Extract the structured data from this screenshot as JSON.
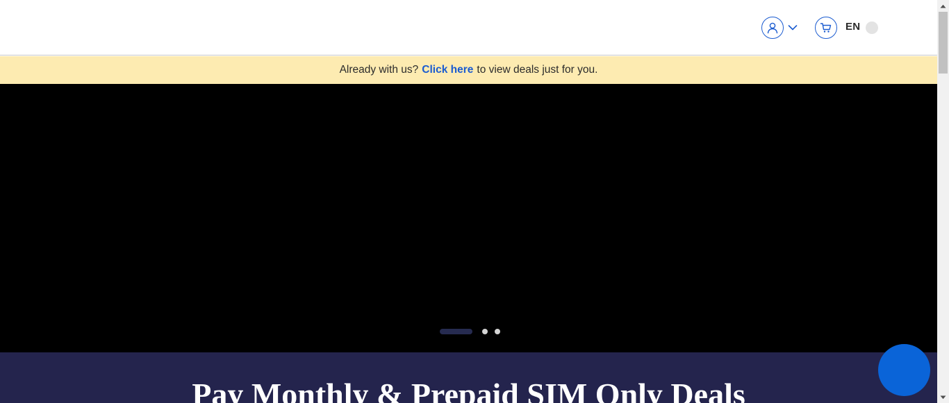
{
  "header": {
    "account_icon": "user-icon",
    "dropdown_icon": "chevron-down-icon",
    "cart_icon": "cart-icon",
    "language": "EN",
    "accent_color": "#1a5bd0"
  },
  "notice": {
    "prefix": "Already with us?",
    "link": "Click here",
    "suffix": "to view deals just for you.",
    "background": "#fdebb1"
  },
  "hero": {
    "carousel_slides": 3,
    "active_slide": 1
  },
  "section": {
    "title": "Pay Monthly & Prepaid SIM Only Deals",
    "background": "#24244d"
  },
  "chat": {
    "icon": "chat-icon",
    "color": "#0a64d8"
  }
}
